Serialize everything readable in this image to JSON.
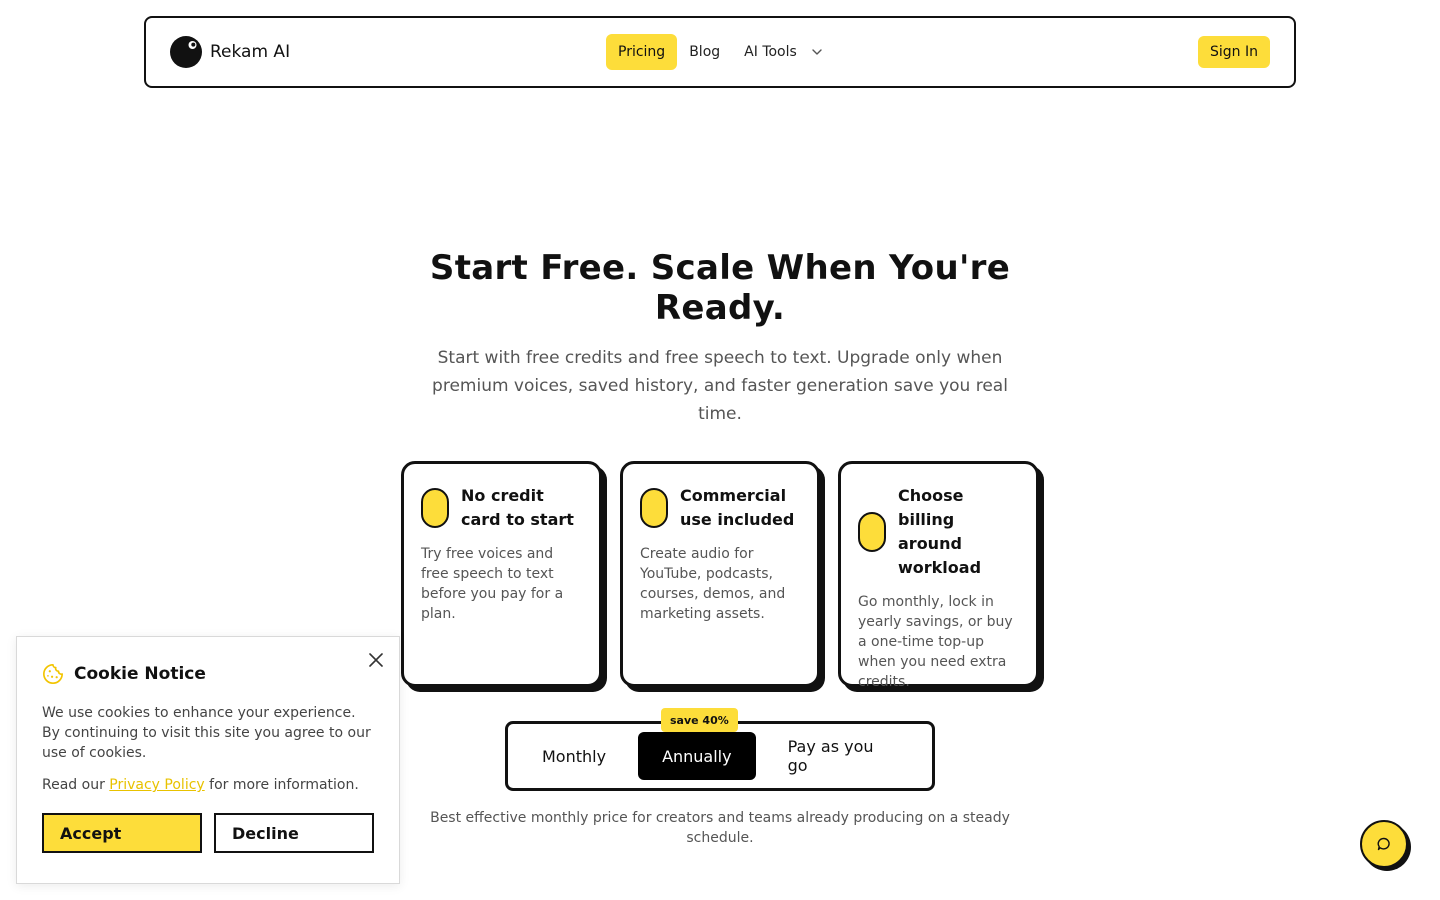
{
  "colors": {
    "accent": "#FDDD3A",
    "ink": "#111111",
    "muted": "#555555"
  },
  "nav": {
    "brand": "Rekam AI",
    "links": [
      {
        "label": "Pricing",
        "active": true
      },
      {
        "label": "Blog",
        "active": false
      },
      {
        "label": "AI Tools",
        "active": false,
        "dropdown": true
      }
    ],
    "signin_label": "Sign In"
  },
  "hero": {
    "title": "Start Free. Scale When You're Ready.",
    "subtitle": "Start with free credits and free speech to text. Upgrade only when premium voices, saved history, and faster generation save you real time."
  },
  "features": [
    {
      "title": "No credit card to start",
      "text": "Try free voices and free speech to text before you pay for a plan."
    },
    {
      "title": "Commercial use included",
      "text": "Create audio for YouTube, podcasts, courses, demos, and marketing assets."
    },
    {
      "title": "Choose billing around workload",
      "text": "Go monthly, lock in yearly savings, or buy a one-time top-up when you need extra credits."
    }
  ],
  "billing": {
    "options": [
      "Monthly",
      "Annually",
      "Pay as you go"
    ],
    "selected": "Annually",
    "badge": "save 40%",
    "note": "Best effective monthly price for creators and teams already producing on a steady schedule."
  },
  "cookie": {
    "title": "Cookie Notice",
    "text": "We use cookies to enhance your experience. By continuing to visit this site you agree to our use of cookies.",
    "read_prefix": "Read our",
    "link_label": "Privacy Policy",
    "read_suffix": "for more information.",
    "accept_label": "Accept",
    "decline_label": "Decline"
  },
  "icons": {
    "chat": "chat-bubble-icon",
    "close": "close-icon",
    "cookie": "cookie-icon",
    "chevron": "chevron-down-icon"
  }
}
